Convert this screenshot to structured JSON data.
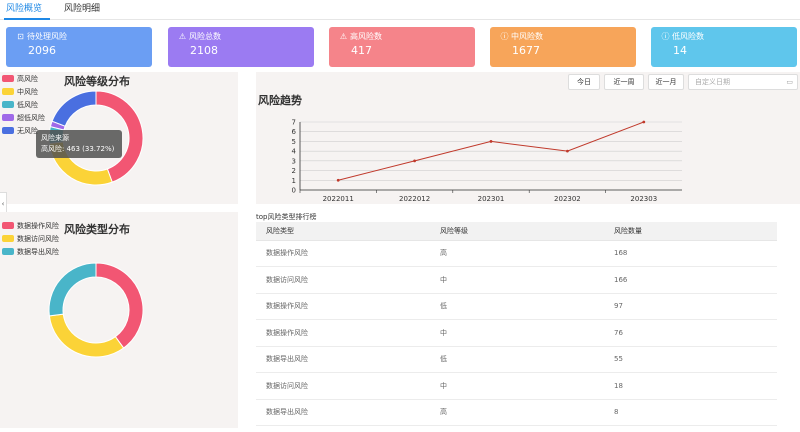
{
  "tabs": [
    {
      "label": "风险概览"
    },
    {
      "label": "风险明细"
    }
  ],
  "cards": [
    {
      "label": "待处理风险",
      "value": "2096",
      "color": "#6b9ef3",
      "icon": "⊡"
    },
    {
      "label": "风险总数",
      "value": "2108",
      "color": "#9b7bf2",
      "icon": "⚠"
    },
    {
      "label": "高风险数",
      "value": "417",
      "color": "#f5848a",
      "icon": "⚠"
    },
    {
      "label": "中风险数",
      "value": "1677",
      "color": "#f7a55a",
      "icon": "ⓘ"
    },
    {
      "label": "低风险数",
      "value": "14",
      "color": "#5fc6ec",
      "icon": "ⓘ"
    }
  ],
  "level_panel": {
    "title": "风险等级分布",
    "legend": [
      {
        "label": "高风险",
        "color": "#f25673"
      },
      {
        "label": "中风险",
        "color": "#fbd337"
      },
      {
        "label": "低风险",
        "color": "#49b5c9"
      },
      {
        "label": "超低风险",
        "color": "#9f69e8"
      },
      {
        "label": "无风险",
        "color": "#4a6fe0"
      }
    ],
    "tooltip": {
      "series": "风险来源",
      "line": "高风险: 463 (33.72%)"
    }
  },
  "type_panel": {
    "title": "风险类型分布",
    "legend": [
      {
        "label": "数据操作风险",
        "color": "#f25673"
      },
      {
        "label": "数据访问风险",
        "color": "#fbd337"
      },
      {
        "label": "数据导出风险",
        "color": "#49b5c9"
      }
    ]
  },
  "trend": {
    "title": "风险趋势",
    "buttons": [
      "今日",
      "近一周",
      "近一月"
    ],
    "date_placeholder": "自定义日期",
    "date_icon": "calendar-icon"
  },
  "table": {
    "caption": "top风险类型排行榜",
    "headers": [
      "风险类型",
      "风险等级",
      "风险数量"
    ],
    "rows": [
      [
        "数据操作风险",
        "高",
        "168"
      ],
      [
        "数据访问风险",
        "中",
        "166"
      ],
      [
        "数据操作风险",
        "低",
        "97"
      ],
      [
        "数据操作风险",
        "中",
        "76"
      ],
      [
        "数据导出风险",
        "低",
        "55"
      ],
      [
        "数据访问风险",
        "中",
        "18"
      ],
      [
        "数据导出风险",
        "高",
        "8"
      ]
    ]
  },
  "chart_data": [
    {
      "type": "pie",
      "title": "风险等级分布",
      "donut": true,
      "categories": [
        "高风险",
        "中风险",
        "低风险",
        "超低风险",
        "无风险"
      ],
      "values": [
        463,
        300,
        60,
        20,
        200
      ],
      "colors": [
        "#f25673",
        "#fbd337",
        "#49b5c9",
        "#9f69e8",
        "#4a6fe0"
      ]
    },
    {
      "type": "pie",
      "title": "风险类型分布",
      "donut": true,
      "categories": [
        "数据操作风险",
        "数据访问风险",
        "数据导出风险"
      ],
      "values": [
        40,
        33,
        27
      ],
      "colors": [
        "#f25673",
        "#fbd337",
        "#49b5c9"
      ]
    },
    {
      "type": "line",
      "title": "风险趋势",
      "x": [
        "2022011",
        "2022012",
        "202301",
        "202302",
        "202303"
      ],
      "y": [
        1,
        3,
        5,
        4,
        7
      ],
      "ylim": [
        0,
        7
      ],
      "yticks": [
        0,
        1,
        2,
        3,
        4,
        5,
        6,
        7
      ],
      "grid": true,
      "color": "#c0392b"
    }
  ]
}
